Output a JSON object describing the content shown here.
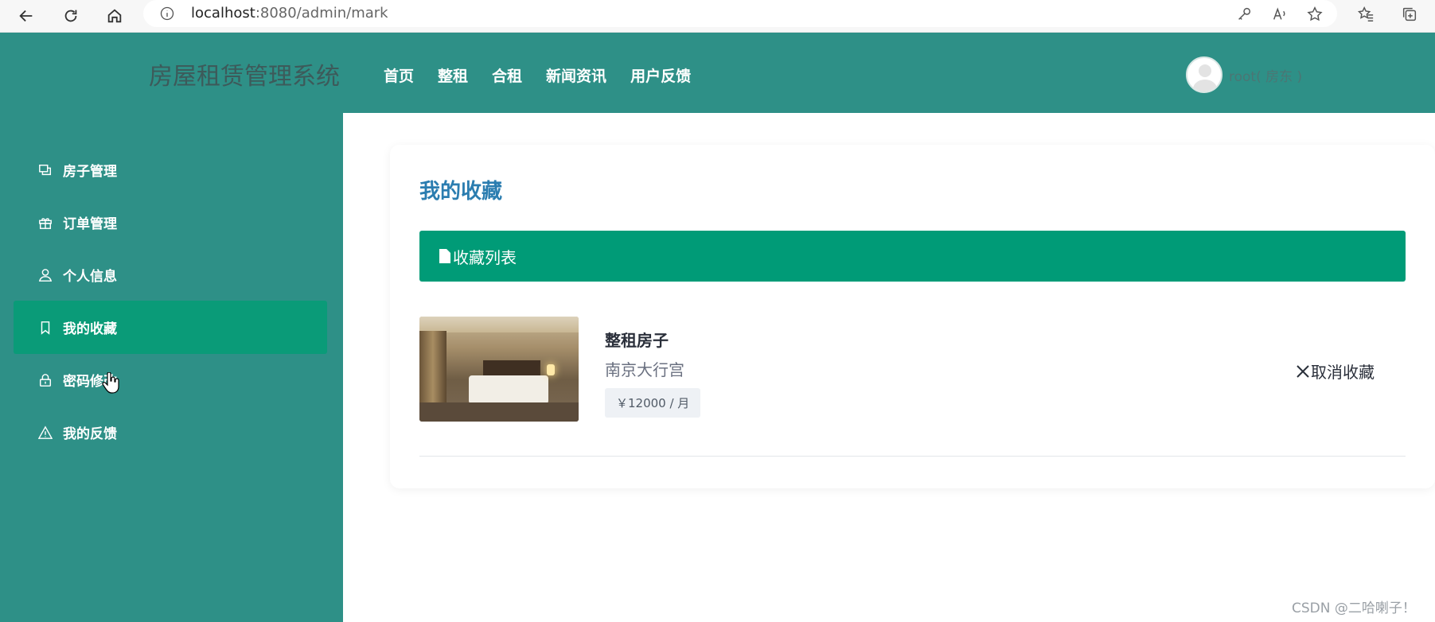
{
  "browser": {
    "url_host": "localhost",
    "url_rest": ":8080/admin/mark",
    "nav_icons": [
      "back-icon",
      "refresh-icon",
      "home-icon"
    ],
    "right_icons": [
      "key-icon",
      "read-aloud-icon",
      "add-favorite-icon",
      "favorites-icon",
      "collections-icon"
    ]
  },
  "header": {
    "app_title": "房屋租赁管理系统",
    "nav": [
      "首页",
      "整租",
      "合租",
      "新闻资讯",
      "用户反馈"
    ],
    "user_label": "root( 房东 )"
  },
  "sidebar": {
    "items": [
      {
        "label": "房子管理",
        "icon": "house-manage-icon",
        "active": false
      },
      {
        "label": "订单管理",
        "icon": "gift-icon",
        "active": false
      },
      {
        "label": "个人信息",
        "icon": "user-icon",
        "active": false
      },
      {
        "label": "我的收藏",
        "icon": "bookmark-icon",
        "active": true
      },
      {
        "label": "密码修改",
        "icon": "lock-icon",
        "active": false
      },
      {
        "label": "我的反馈",
        "icon": "warning-icon",
        "active": false
      }
    ]
  },
  "main": {
    "page_title": "我的收藏",
    "list_header": "收藏列表",
    "favorites": [
      {
        "type": "整租房子",
        "location": "南京大行宫",
        "price": "￥12000 / 月",
        "cancel_label": "取消收藏"
      }
    ]
  },
  "colors": {
    "header_bg": "#2e9087",
    "active_item": "#0a9b78",
    "list_header_bg": "#009b77",
    "page_title": "#2b7db0"
  },
  "watermark": "CSDN @二哈喇子！"
}
